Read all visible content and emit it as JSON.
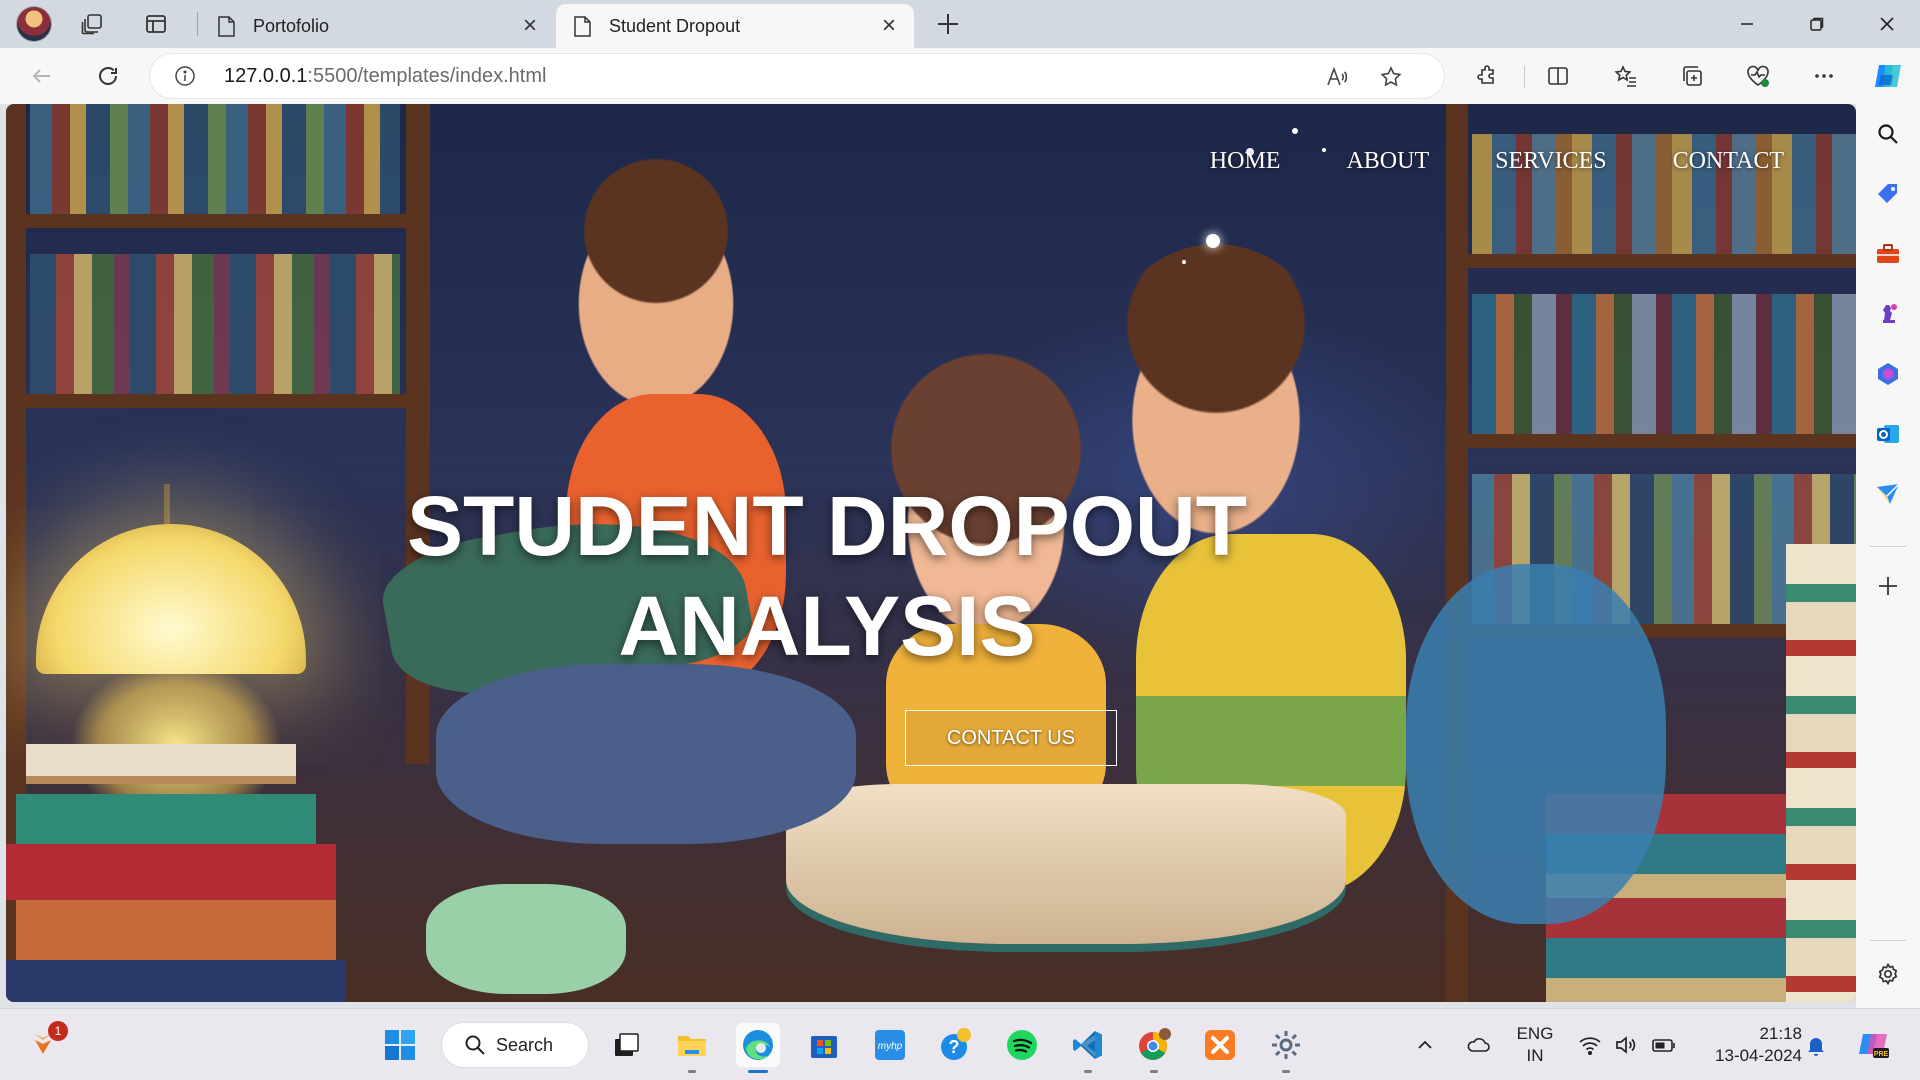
{
  "tabs": [
    {
      "title": "Portofolio"
    },
    {
      "title": "Student Dropout"
    }
  ],
  "address": {
    "host": "127.0.0.1",
    "rest": ":5500/templates/index.html"
  },
  "site": {
    "nav": [
      "HOME",
      "ABOUT",
      "SERVICES",
      "CONTACT"
    ],
    "title_line1": "STUDENT DROPOUT",
    "title_line2": "ANALYSIS",
    "cta": "CONTACT US"
  },
  "taskbar": {
    "search_label": "Search",
    "notification_count": "1",
    "lang_line1": "ENG",
    "lang_line2": "IN",
    "time": "21:18",
    "date": "13-04-2024"
  },
  "colors": {
    "accent": "#1a73c8",
    "tab_bar": "#d3d9e0",
    "toolbar": "#f7f7f7",
    "taskbar": "#eae7ef"
  }
}
